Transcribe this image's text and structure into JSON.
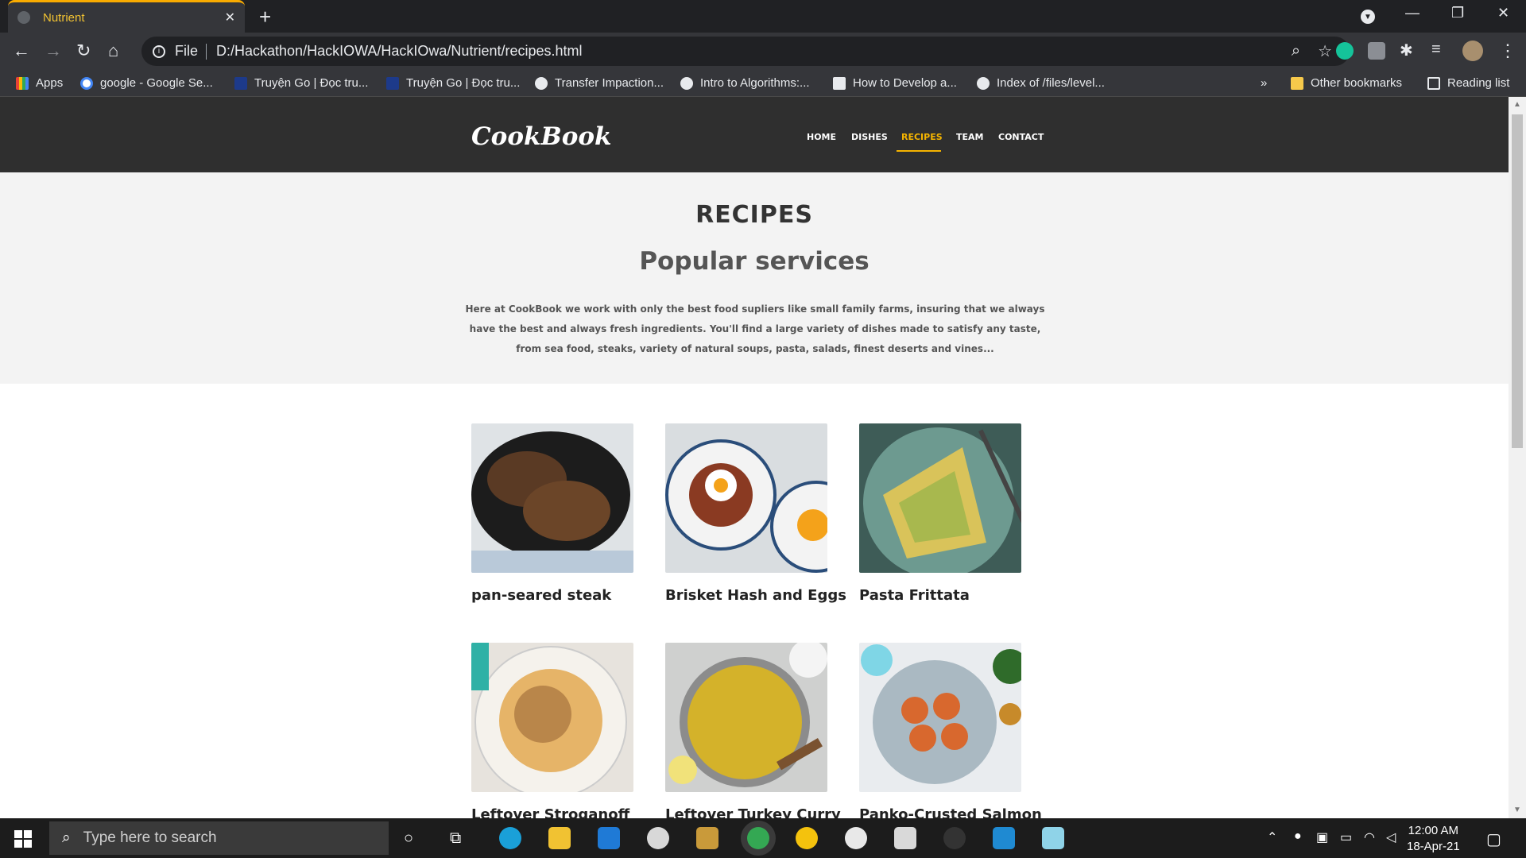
{
  "browser": {
    "tab_title": "Nutrient",
    "tab_close": "✕",
    "new_tab": "+",
    "url_scheme": "File",
    "url": "D:/Hackathon/HackIOWA/HackIOwa/Nutrient/recipes.html"
  },
  "bookmarks": {
    "items": [
      "Apps",
      "google - Google Se...",
      "Truyện Go | Đọc tru...",
      "Truyện Go | Đọc tru...",
      "Transfer Impaction...",
      "Intro to Algorithms:...",
      "How to Develop a...",
      "Index of /files/level..."
    ],
    "overflow": "»",
    "other": "Other bookmarks",
    "reading_list": "Reading list"
  },
  "site": {
    "logo": "CookBook",
    "nav": [
      "HOME",
      "DISHES",
      "RECIPES",
      "TEAM",
      "CONTACT"
    ],
    "active_nav": "RECIPES",
    "accent": "#f5b400"
  },
  "hero": {
    "title": "RECIPES",
    "subtitle": "Popular services",
    "description": "Here at CookBook we work with only the best food supliers like small family farms, insuring that we always have the best and always fresh ingredients. You'll find a large variety of dishes made to satisfy any taste, from sea food, steaks, variety of natural soups, pasta, salads, finest deserts and vines..."
  },
  "recipes": [
    {
      "name": "pan-seared steak"
    },
    {
      "name": "Brisket Hash and Eggs"
    },
    {
      "name": "Pasta Frittata"
    },
    {
      "name": "Leftover Stroganoff"
    },
    {
      "name": "Leftover Turkey Curry"
    },
    {
      "name": "Panko-Crusted Salmon"
    }
  ],
  "taskbar": {
    "search_placeholder": "Type here to search",
    "time": "12:00 AM",
    "date": "18-Apr-21"
  }
}
